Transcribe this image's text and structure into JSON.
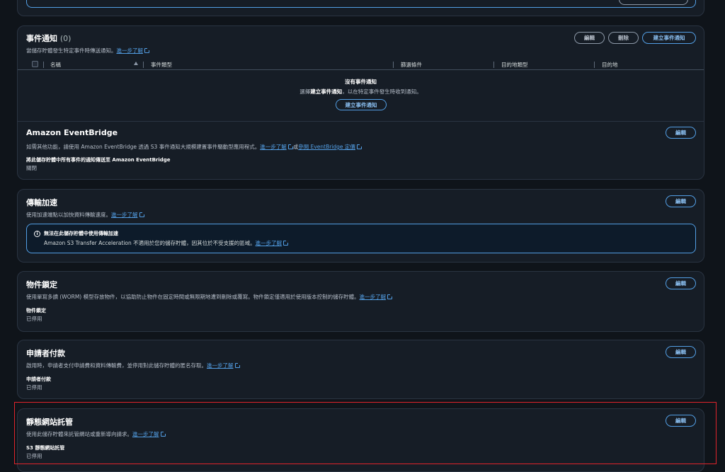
{
  "event_notifications": {
    "title": "事件通知",
    "count": "(0)",
    "description": "當儲存貯體發生特定事件時傳送通知。",
    "learn_more": "進一步了解",
    "buttons": {
      "edit": "編輯",
      "delete": "刪除",
      "create": "建立事件通知"
    },
    "columns": [
      "名稱",
      "事件類型",
      "篩選條件",
      "目的地類型",
      "目的地"
    ],
    "empty_title": "沒有事件通知",
    "empty_desc_prefix": "選擇",
    "empty_desc_bold": "建立事件通知",
    "empty_desc_suffix": "，以在特定事件發生時收到通知。",
    "empty_button": "建立事件通知"
  },
  "eventbridge": {
    "title": "Amazon EventBridge",
    "description": "如需其他功能，請使用 Amazon EventBridge 透過 S3 事件通知大規模建置事件驅動型應用程式。",
    "learn_more": "進一步了解",
    "or": "或",
    "pricing": "參閱 EventBridge 定價",
    "edit": "編輯",
    "label": "將此儲存貯體中所有事件的通知傳送至 Amazon EventBridge",
    "value": "關閉"
  },
  "transfer_acceleration": {
    "title": "傳輸加速",
    "description": "使用加速端點以加快資料傳輸速度。",
    "learn_more": "進一步了解",
    "edit": "編輯",
    "info_icon": "info-icon",
    "info_title": "無法在此儲存貯體中使用傳輸加速",
    "info_desc": "Amazon S3 Transfer Acceleration 不適用於您的儲存貯體，因其位於不受支援的區域。",
    "info_learn_more": "進一步了解"
  },
  "object_lock": {
    "title": "物件鎖定",
    "description": "使用單寫多讀 (WORM) 模型存放物件，以協助防止物件在固定時間或無限期地遭到刪除或覆寫。物件鎖定僅適用於使用版本控制的儲存貯體。",
    "learn_more": "進一步了解",
    "edit": "編輯",
    "label": "物件鎖定",
    "value": "已停用"
  },
  "requester_pays": {
    "title": "申請者付款",
    "description": "啟用時，申請者支付申請費和資料傳輸費，並停用對此儲存貯體的匿名存取。",
    "learn_more": "進一步了解",
    "edit": "編輯",
    "label": "申請者付款",
    "value": "已停用"
  },
  "static_website": {
    "title": "靜態網站託管",
    "description": "使用此儲存貯體來託管網站或重新導向請求。",
    "learn_more": "進一步了解",
    "edit": "編輯",
    "label": "S3 靜態網站託管",
    "value": "已停用"
  },
  "colors": {
    "background": "#0f141a",
    "card": "#161d26",
    "accent": "#539fe5",
    "highlight": "#e0242b"
  }
}
